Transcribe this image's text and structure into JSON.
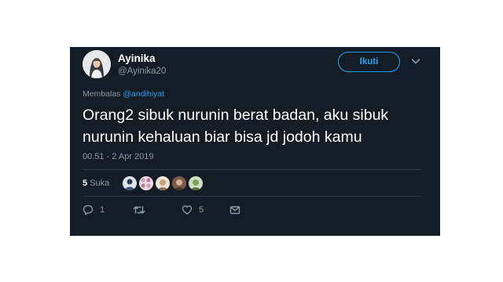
{
  "tweet": {
    "author": {
      "display_name": "Ayinika",
      "handle": "@Ayinika20"
    },
    "follow_label": "Ikuti",
    "reply_prefix": "Membalas",
    "reply_mention": "@andihiyat",
    "text": "Orang2 sibuk nurunin berat badan, aku sibuk nurunin kehaluan biar bisa jd jodoh kamu",
    "timestamp": "00.51 - 2 Apr 2019",
    "likes": {
      "count": "5",
      "label": "Suka"
    },
    "actions": {
      "reply_count": "1",
      "retweet_count": "",
      "like_count": "5"
    }
  },
  "icons": {
    "more": "chevron-down-icon",
    "reply": "reply-icon",
    "retweet": "retweet-icon",
    "like": "heart-icon",
    "message": "envelope-icon"
  },
  "colors": {
    "background": "#141d26",
    "accent": "#1da1f2",
    "muted": "#8899a6",
    "divider": "#2f3c48"
  }
}
